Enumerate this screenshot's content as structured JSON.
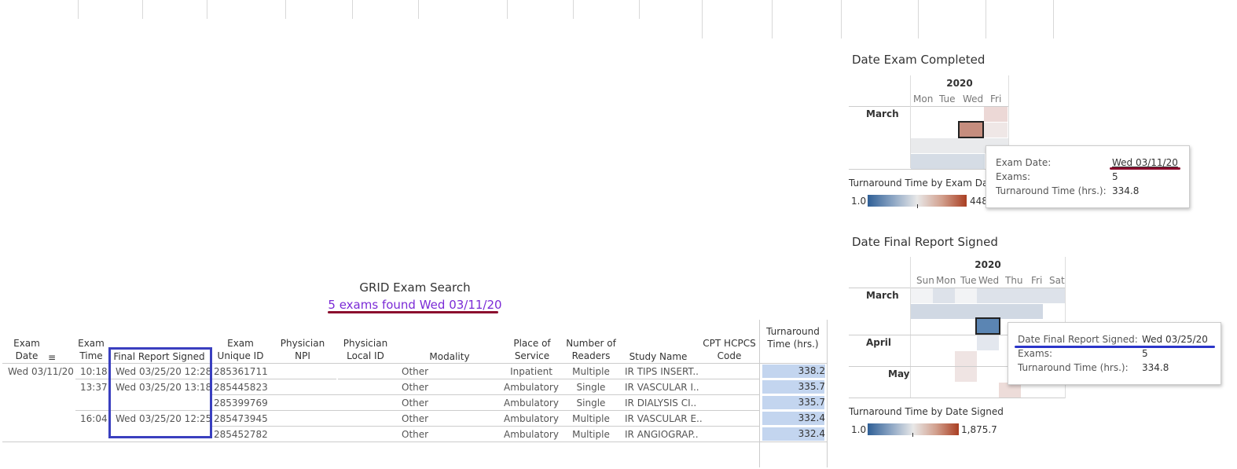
{
  "grid": {
    "title": "GRID Exam Search",
    "found_count": "5 exams found",
    "found_date": "Wed 03/11/20",
    "headers": {
      "exam_date": "Exam\nDate",
      "exam_time": "Exam\nTime",
      "final_report": "Final Report Signed",
      "exam_uid": "Exam\nUnique ID",
      "phys_npi": "Physician\nNPI",
      "phys_local": "Physician\nLocal ID",
      "modality": "Modality",
      "place": "Place of\nService",
      "readers": "Number of\nReaders",
      "study": "Study Name",
      "cpt": "CPT HCPCS\nCode",
      "turnaround": "Turnaround\nTime (hrs.)"
    },
    "exam_date_value": "Wed 03/11/20",
    "rows": [
      {
        "time": "10:18",
        "signed": "Wed 03/25/20 12:28",
        "uid": "285361711",
        "modality": "Other",
        "place": "Inpatient",
        "readers": "Multiple",
        "study": "IR TIPS INSERT..",
        "tat": "338.2",
        "tat_num": 338.2
      },
      {
        "time": "13:37",
        "signed": "Wed 03/25/20 13:18",
        "uid": "285445823",
        "modality": "Other",
        "place": "Ambulatory",
        "readers": "Single",
        "study": "IR VASCULAR I..",
        "tat": "335.7",
        "tat_num": 335.7
      },
      {
        "time": "",
        "signed": "",
        "uid": "285399769",
        "modality": "Other",
        "place": "Ambulatory",
        "readers": "Single",
        "study": "IR DIALYSIS CI..",
        "tat": "335.7",
        "tat_num": 335.7
      },
      {
        "time": "16:04",
        "signed": "Wed 03/25/20 12:25",
        "uid": "285473945",
        "modality": "Other",
        "place": "Ambulatory",
        "readers": "Multiple",
        "study": "IR VASCULAR E..",
        "tat": "332.4",
        "tat_num": 332.4
      },
      {
        "time": "",
        "signed": "",
        "uid": "285452782",
        "modality": "Other",
        "place": "Ambulatory",
        "readers": "Multiple",
        "study": "IR ANGIOGRAP..",
        "tat": "332.4",
        "tat_num": 332.4
      }
    ]
  },
  "cal_completed": {
    "title": "Date Exam Completed",
    "year": "2020",
    "days": [
      "Mon",
      "Tue",
      "Wed",
      "Fri"
    ],
    "month": "March",
    "legend_title": "Turnaround Time by Exam Date",
    "legend_min": "1.0",
    "legend_max": "448",
    "tooltip": {
      "k1": "Exam Date:",
      "v1": "Wed 03/11/20",
      "k2": "Exams:",
      "v2": "5",
      "k3": "Turnaround Time (hrs.):",
      "v3": "334.8"
    }
  },
  "cal_signed": {
    "title": "Date Final Report Signed",
    "year": "2020",
    "days": [
      "Sun",
      "Mon",
      "Tue",
      "Wed",
      "Thu",
      "Fri",
      "Sat"
    ],
    "months": [
      "March",
      "April",
      "May"
    ],
    "legend_title": "Turnaround Time by Date Signed",
    "legend_min": "1.0",
    "legend_max": "1,875.7",
    "tooltip": {
      "k1": "Date Final Report Signed:",
      "v1": "Wed 03/25/20",
      "k2": "Exams:",
      "v2": "5",
      "k3": "Turnaround Time (hrs.):",
      "v3": "334.8"
    }
  },
  "colors": {
    "accent_purple": "#7b2bd6",
    "annotation_red": "#8b0d2e",
    "annotation_blue": "#2b35c9",
    "bar_fill": "#c3d5ef",
    "highlight_box": "#3a3fbf"
  }
}
